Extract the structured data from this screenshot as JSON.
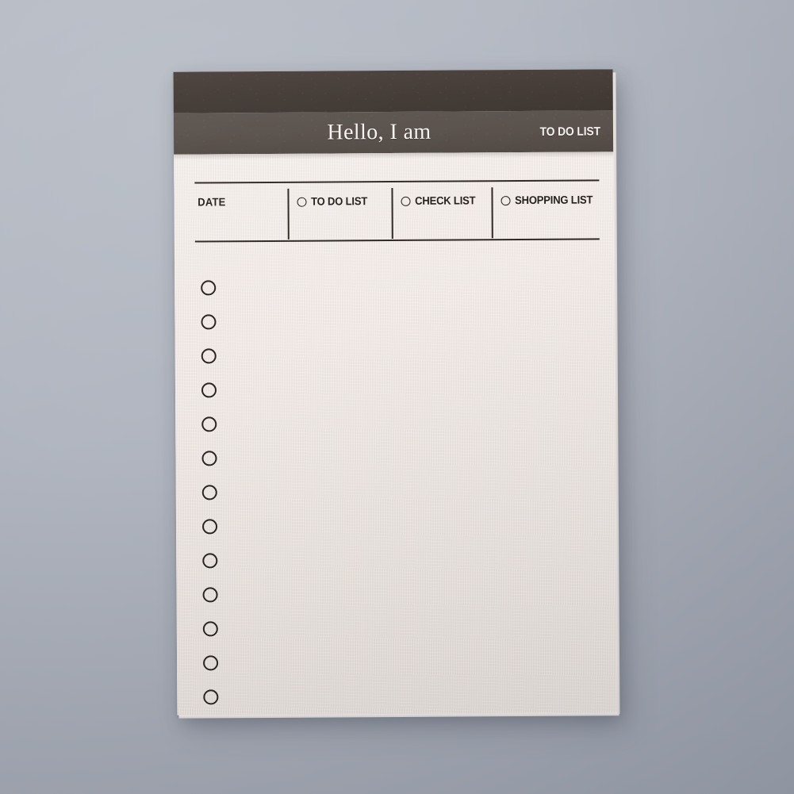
{
  "scene": {
    "background_color": "#aeb3bd",
    "background_color_shadow": "#9aa0ac"
  },
  "notepad": {
    "paper_color": "#f0e8e4",
    "band_dark_color": "#3e3530",
    "band_mid_color": "#564d48",
    "ink_color": "#2e2723",
    "header": {
      "title": "Hello, I am",
      "tag": "TO DO LIST"
    },
    "table": {
      "columns": [
        {
          "label": "DATE",
          "has_bullet": false
        },
        {
          "label": "TO DO LIST",
          "has_bullet": true
        },
        {
          "label": "CHECK LIST",
          "has_bullet": true
        },
        {
          "label": "SHOPPING LIST",
          "has_bullet": true
        }
      ]
    },
    "checklist": {
      "count": 13,
      "rows": [
        {
          "checked": false
        },
        {
          "checked": false
        },
        {
          "checked": false
        },
        {
          "checked": false
        },
        {
          "checked": false
        },
        {
          "checked": false
        },
        {
          "checked": false
        },
        {
          "checked": false
        },
        {
          "checked": false
        },
        {
          "checked": false
        },
        {
          "checked": false
        },
        {
          "checked": false
        },
        {
          "checked": false
        }
      ]
    }
  }
}
